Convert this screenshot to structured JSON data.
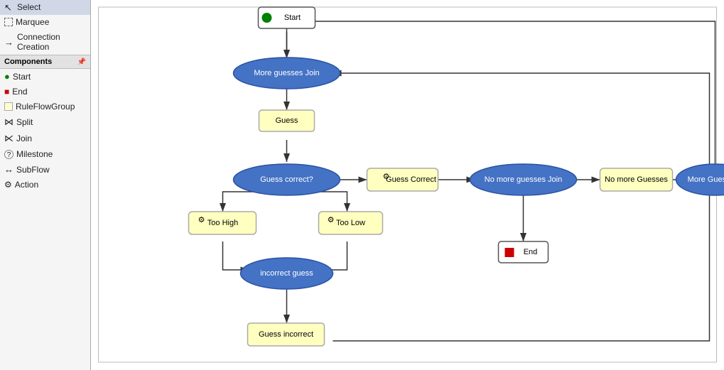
{
  "sidebar": {
    "title": "Components",
    "tools": [
      {
        "id": "select",
        "label": "Select",
        "icon": "cursor",
        "selected": true
      },
      {
        "id": "marquee",
        "label": "Marquee",
        "icon": "marquee"
      },
      {
        "id": "connection",
        "label": "Connection Creation",
        "icon": "arrow"
      }
    ],
    "components": [
      {
        "id": "start",
        "label": "Start",
        "icon": "start"
      },
      {
        "id": "end",
        "label": "End",
        "icon": "end"
      },
      {
        "id": "ruleflowgroup",
        "label": "RuleFlowGroup",
        "icon": "ruleflow"
      },
      {
        "id": "split",
        "label": "Split",
        "icon": "split"
      },
      {
        "id": "join",
        "label": "Join",
        "icon": "join"
      },
      {
        "id": "milestone",
        "label": "Milestone",
        "icon": "milestone"
      },
      {
        "id": "subflow",
        "label": "SubFlow",
        "icon": "subflow"
      },
      {
        "id": "action",
        "label": "Action",
        "icon": "action"
      }
    ]
  },
  "diagram": {
    "nodes": {
      "start": {
        "label": "Start",
        "type": "start"
      },
      "more_guesses_join": {
        "label": "More guesses Join",
        "type": "join"
      },
      "guess": {
        "label": "Guess",
        "type": "ruleflow"
      },
      "guess_correct": {
        "label": "Guess  correct?",
        "type": "split"
      },
      "guess_correct_action": {
        "label": "Guess Correct",
        "type": "action"
      },
      "no_more_guesses_join": {
        "label": "No more guesses Join",
        "type": "join"
      },
      "no_more_guesses": {
        "label": "No more Guesses",
        "type": "action"
      },
      "more_guesses": {
        "label": "More Guesses?",
        "type": "split"
      },
      "too_high": {
        "label": "Too High",
        "type": "action"
      },
      "too_low": {
        "label": "Too Low",
        "type": "action"
      },
      "incorrect_guess": {
        "label": "incorrect guess",
        "type": "join"
      },
      "guess_incorrect": {
        "label": "Guess incorrect",
        "type": "ruleflow"
      },
      "end": {
        "label": "End",
        "type": "end"
      }
    }
  }
}
